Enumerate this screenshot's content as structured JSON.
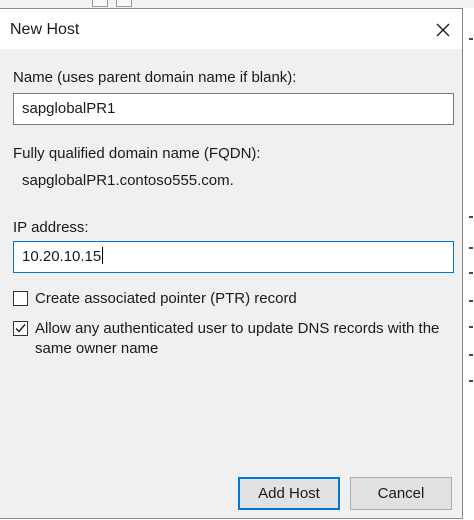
{
  "dialog": {
    "title": "New Host",
    "close_icon": "close-icon"
  },
  "name_field": {
    "label": "Name (uses parent domain name if blank):",
    "value": "sapglobalPR1"
  },
  "fqdn_field": {
    "label": "Fully qualified domain name (FQDN):",
    "value": "sapglobalPR1.contoso555.com."
  },
  "ip_field": {
    "label": "IP address:",
    "value": "10.20.10.15"
  },
  "ptr_checkbox": {
    "label": "Create associated pointer (PTR) record",
    "checked": false
  },
  "update_checkbox": {
    "label": "Allow any authenticated user to update DNS records with the same owner name",
    "checked": true
  },
  "buttons": {
    "add_host": "Add Host",
    "cancel": "Cancel"
  },
  "colors": {
    "dialog_bg": "#f0f0f0",
    "focus_blue": "#0078d7"
  }
}
